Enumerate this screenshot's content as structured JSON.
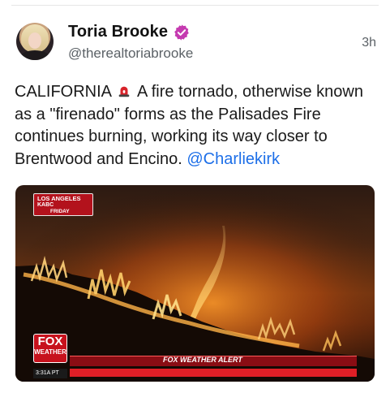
{
  "post": {
    "author_name": "Toria Brooke",
    "handle": "@therealtoriabrooke",
    "time": "3h",
    "text_part1": "CALIFORNIA",
    "text_part2": " A fire tornado, otherwise known as a \"firenado\" forms as the Palisades Fire continues burning, working its way closer to Brentwood and Encino. ",
    "mention": "@Charliekirk",
    "icons": {
      "verified": "verified-badge-icon",
      "siren": "siren-icon"
    },
    "colors": {
      "verified": "#c53ab0",
      "mention": "#1d6fe8",
      "siren": "#d8232a"
    }
  },
  "media": {
    "location_line1": "LOS ANGELES",
    "location_line2": "KABC",
    "location_line3": "FRIDAY",
    "logo_top": "FOX",
    "logo_bottom": "WEATHER",
    "alert_label": "FOX WEATHER ALERT",
    "clock": "3:31A PT"
  }
}
